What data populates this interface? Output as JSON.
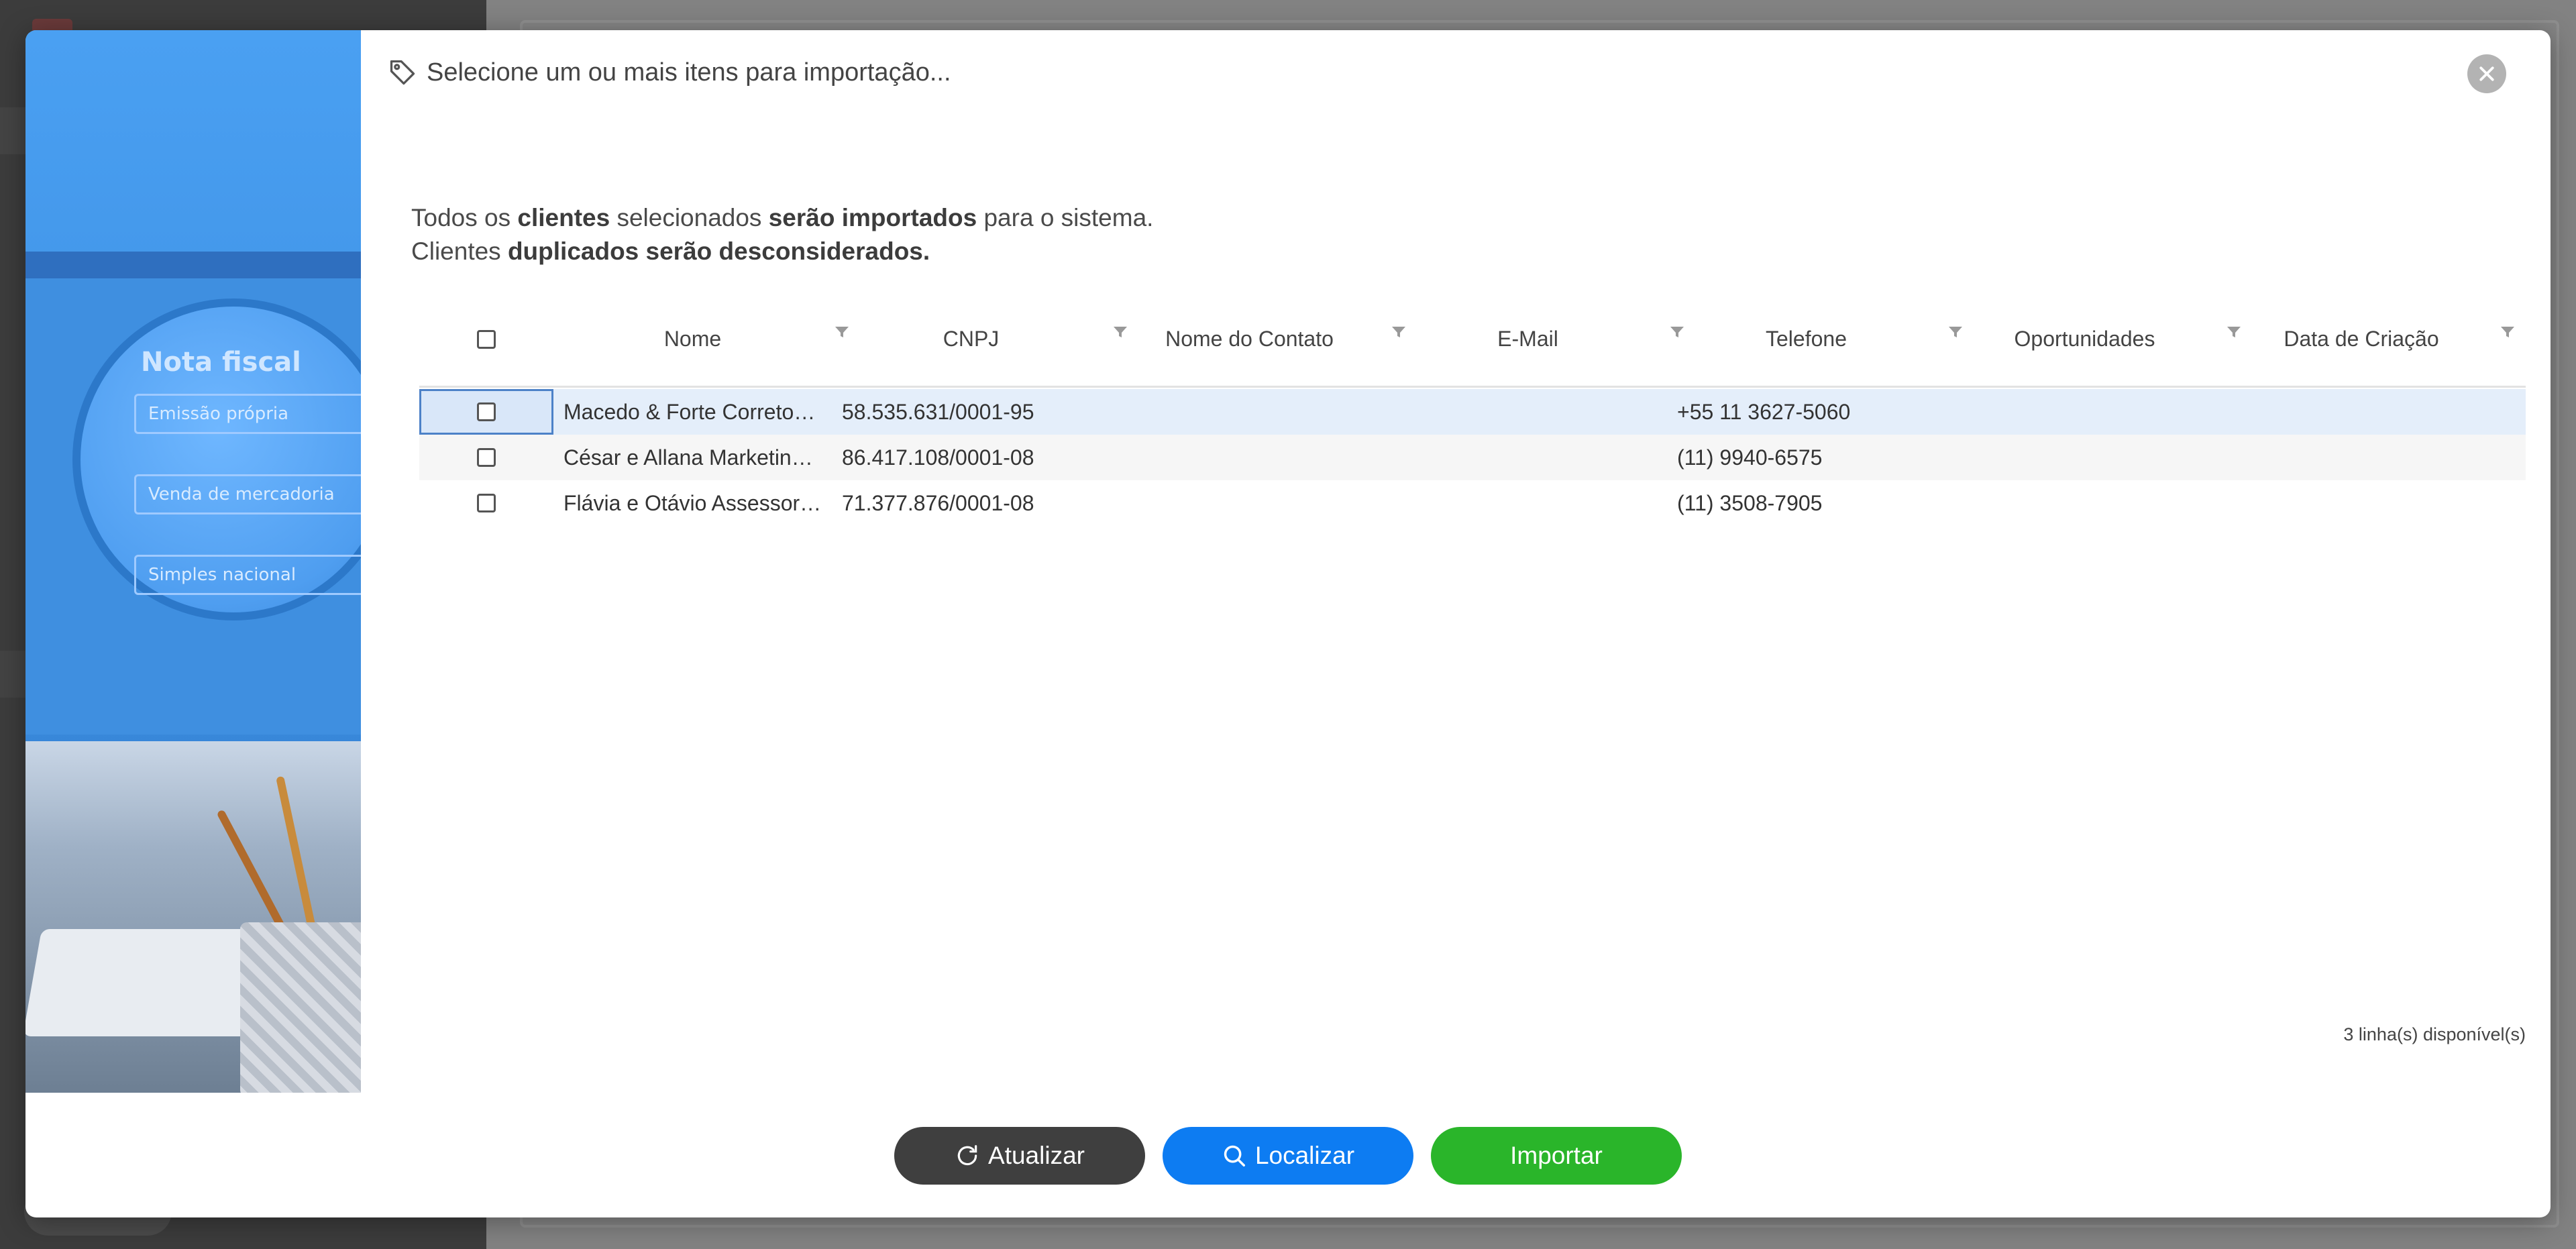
{
  "modal": {
    "title": "Selecione um ou mais itens para importação...",
    "intro_line1": {
      "p1": "Todos os ",
      "b1": "clientes",
      "p2": " selecionados ",
      "b2": "serão importados",
      "p3": " para o sistema."
    },
    "intro_line2": {
      "p1": "Clientes ",
      "b1": "duplicados serão desconsiderados."
    },
    "art": {
      "heading": "Nota fiscal",
      "field1": "Emissão própria",
      "field2": "Venda de mercadoria",
      "field3": "Simples nacional"
    }
  },
  "grid": {
    "columns": [
      "Nome",
      "CNPJ",
      "Nome do Contato",
      "E-Mail",
      "Telefone",
      "Oportunidades",
      "Data de Criação"
    ],
    "rows": [
      {
        "nome": "Macedo & Forte Corretores",
        "cnpj": "58.535.631/0001-95",
        "contato": "",
        "email": "",
        "telefone": "+55 11 3627-5060",
        "oportunidades": "",
        "data": ""
      },
      {
        "nome": "César e Allana Marketing ME",
        "cnpj": "86.417.108/0001-08",
        "contato": "",
        "email": "",
        "telefone": "(11) 9940-6575",
        "oportunidades": "",
        "data": ""
      },
      {
        "nome": "Flávia e Otávio Assessoria ME",
        "cnpj": "71.377.876/0001-08",
        "contato": "",
        "email": "",
        "telefone": "(11) 3508-7905",
        "oportunidades": "",
        "data": ""
      }
    ],
    "rows_count": "3 linha(s) disponível(s)"
  },
  "buttons": {
    "refresh": "Atualizar",
    "find": "Localizar",
    "import": "Importar"
  },
  "icons": {
    "title": "tag-icon",
    "close": "close-icon",
    "refresh": "refresh-icon",
    "find": "search-icon",
    "filter": "filter-icon"
  },
  "colors": {
    "refresh_button": "#3f3f3f",
    "find_button": "#0d7cf2",
    "import_button": "#2ab52a",
    "selected_row": "#e4eefa"
  }
}
